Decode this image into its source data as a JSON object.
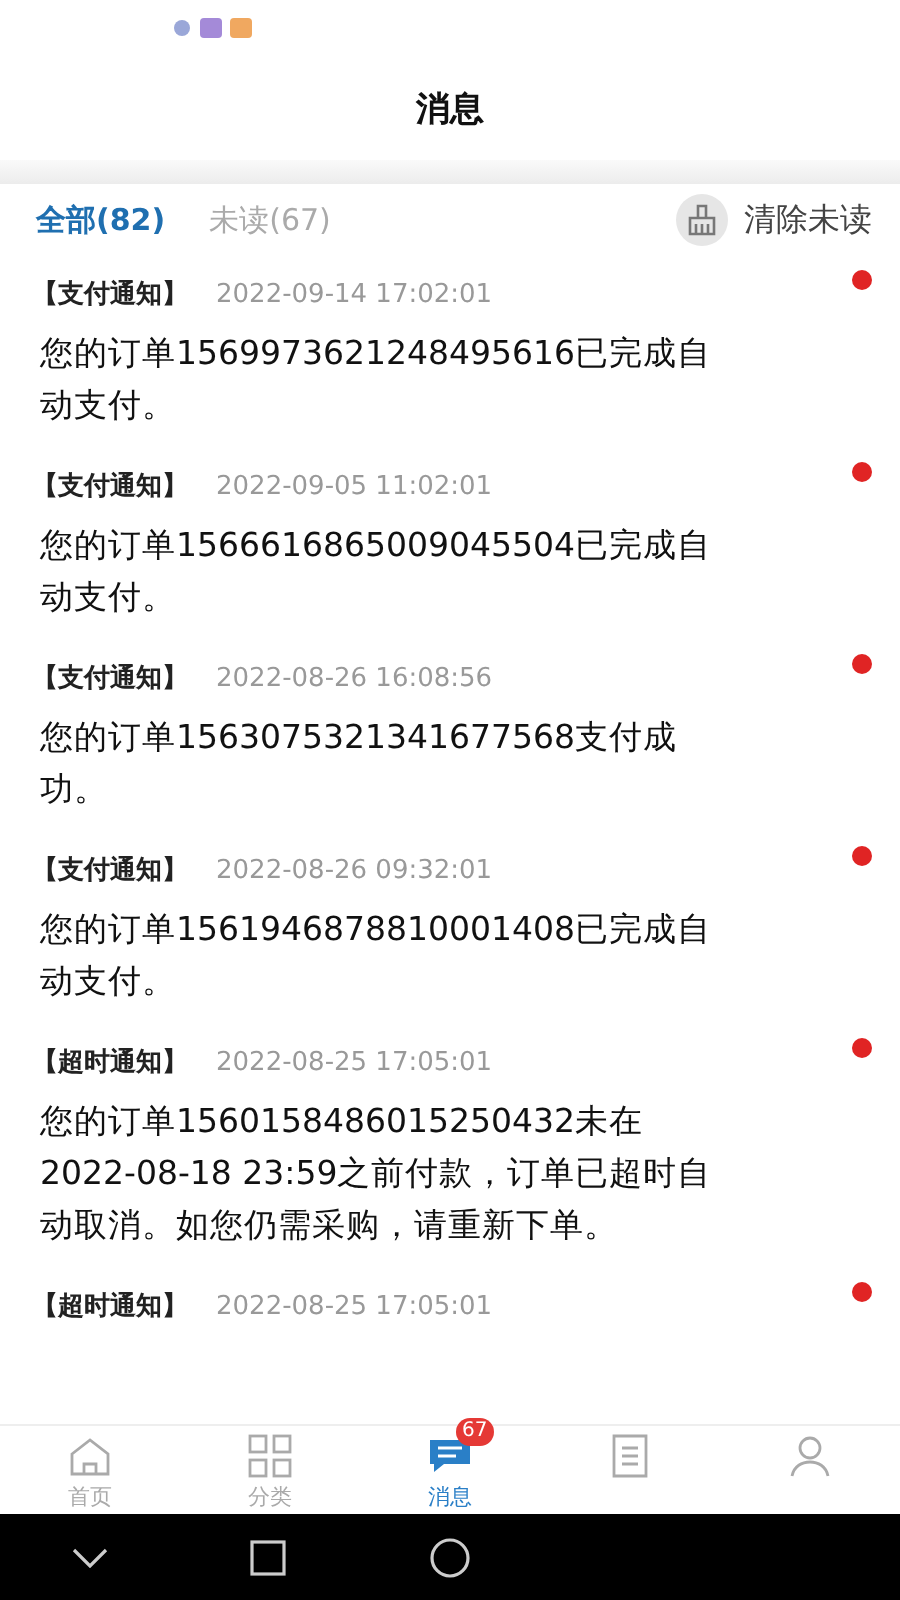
{
  "header": {
    "title": "消息"
  },
  "filters": [
    {
      "label": "全部(82)",
      "selected": true
    },
    {
      "label": "未读(67)",
      "selected": false
    }
  ],
  "clear_button": {
    "label": "清除未读"
  },
  "messages": [
    {
      "category": "【支付通知】",
      "time": "2022-09-14 17:02:01",
      "body": "您的订单1569973621248495616已完成自动支付。",
      "unread": true
    },
    {
      "category": "【支付通知】",
      "time": "2022-09-05 11:02:01",
      "body": "您的订单1566616865009045504已完成自动支付。",
      "unread": true
    },
    {
      "category": "【支付通知】",
      "time": "2022-08-26 16:08:56",
      "body": "您的订单1563075321341677568支付成功。",
      "unread": true
    },
    {
      "category": "【支付通知】",
      "time": "2022-08-26 09:32:01",
      "body": "您的订单1561946878810001408已完成自动支付。",
      "unread": true
    },
    {
      "category": "【超时通知】",
      "time": "2022-08-25 17:05:01",
      "body": "您的订单1560158486015250432未在2022-08-18 23:59之前付款，订单已超时自动取消。如您仍需采购，请重新下单。",
      "unread": true
    },
    {
      "category": "【超时通知】",
      "time": "2022-08-25 17:05:01",
      "unread": true
    }
  ],
  "tab_bar": [
    {
      "kind": "home",
      "label": "首页",
      "selected": false
    },
    {
      "kind": "grid",
      "label": "分类",
      "selected": false
    },
    {
      "kind": "chat",
      "label": "消息",
      "selected": true,
      "badge": "67"
    },
    {
      "kind": "doc",
      "selected": false
    },
    {
      "kind": "user",
      "selected": false
    }
  ]
}
